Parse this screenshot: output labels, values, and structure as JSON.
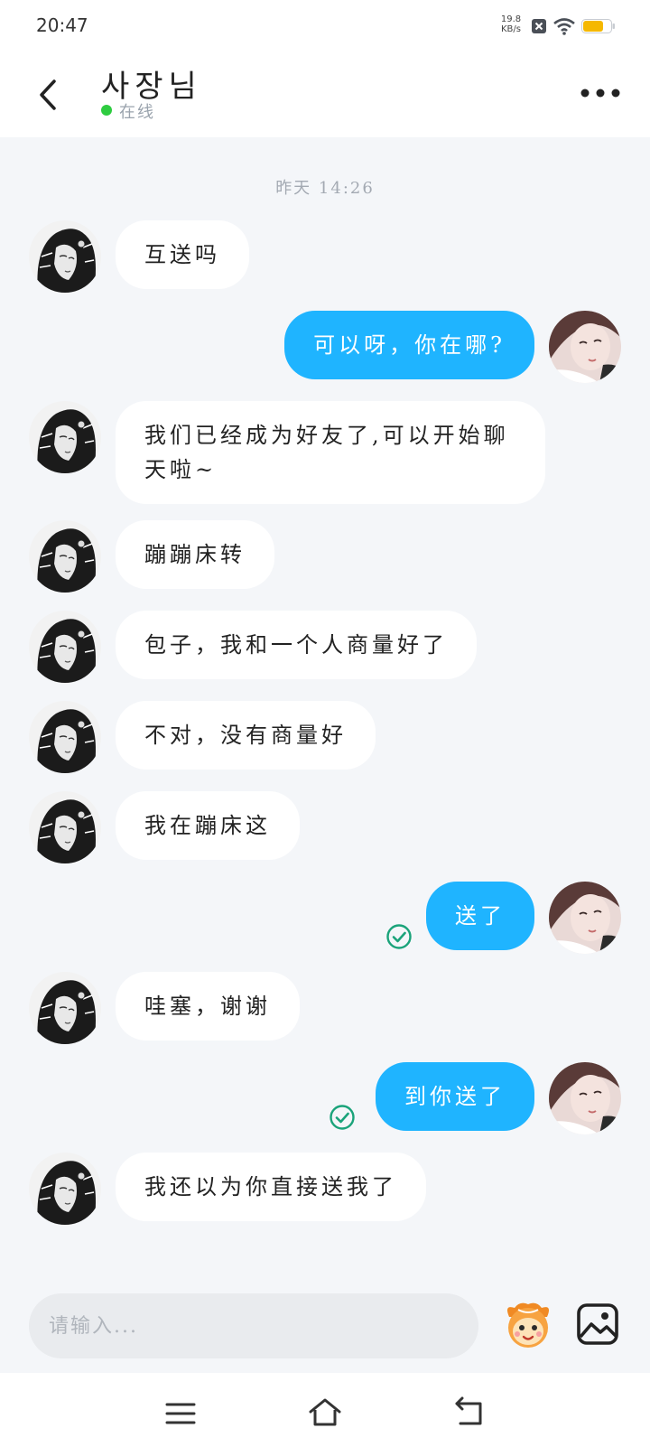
{
  "status_bar": {
    "time": "20:47",
    "net_speed_value": "19.8",
    "net_speed_unit": "KB/s"
  },
  "header": {
    "contact_name": "사장님",
    "status": "在线"
  },
  "chat": {
    "timestamp": "昨天 14:26",
    "messages": [
      {
        "side": "in",
        "text": "互送吗"
      },
      {
        "side": "out",
        "text": "可以呀，你在哪?"
      },
      {
        "side": "in",
        "text": "我们已经成为好友了,可以开始聊天啦~"
      },
      {
        "side": "in",
        "text": "蹦蹦床转"
      },
      {
        "side": "in",
        "text": "包子，我和一个人商量好了"
      },
      {
        "side": "in",
        "text": "不对，没有商量好"
      },
      {
        "side": "in",
        "text": "我在蹦床这"
      },
      {
        "side": "out",
        "text": "送了",
        "read": true
      },
      {
        "side": "in",
        "text": "哇塞，谢谢"
      },
      {
        "side": "out",
        "text": "到你送了",
        "read": true
      },
      {
        "side": "in",
        "text": "我还以为你直接送我了"
      }
    ]
  },
  "input": {
    "placeholder": "请输入..."
  },
  "icons": {
    "back": "chevron-left-icon",
    "more": "more-dots-icon",
    "emoji": "emoji-mascot-icon",
    "image": "image-icon",
    "read_check": "check-circle-icon",
    "nav_menu": "menu-icon",
    "nav_home": "home-icon",
    "nav_back": "back-arrow-icon"
  },
  "colors": {
    "outgoing_bubble": "#1fb4ff",
    "incoming_bubble": "#ffffff",
    "online_dot": "#2ecc40",
    "read_check": "#1aa37a",
    "battery": "#f5b800",
    "background": "#f4f6f9"
  }
}
